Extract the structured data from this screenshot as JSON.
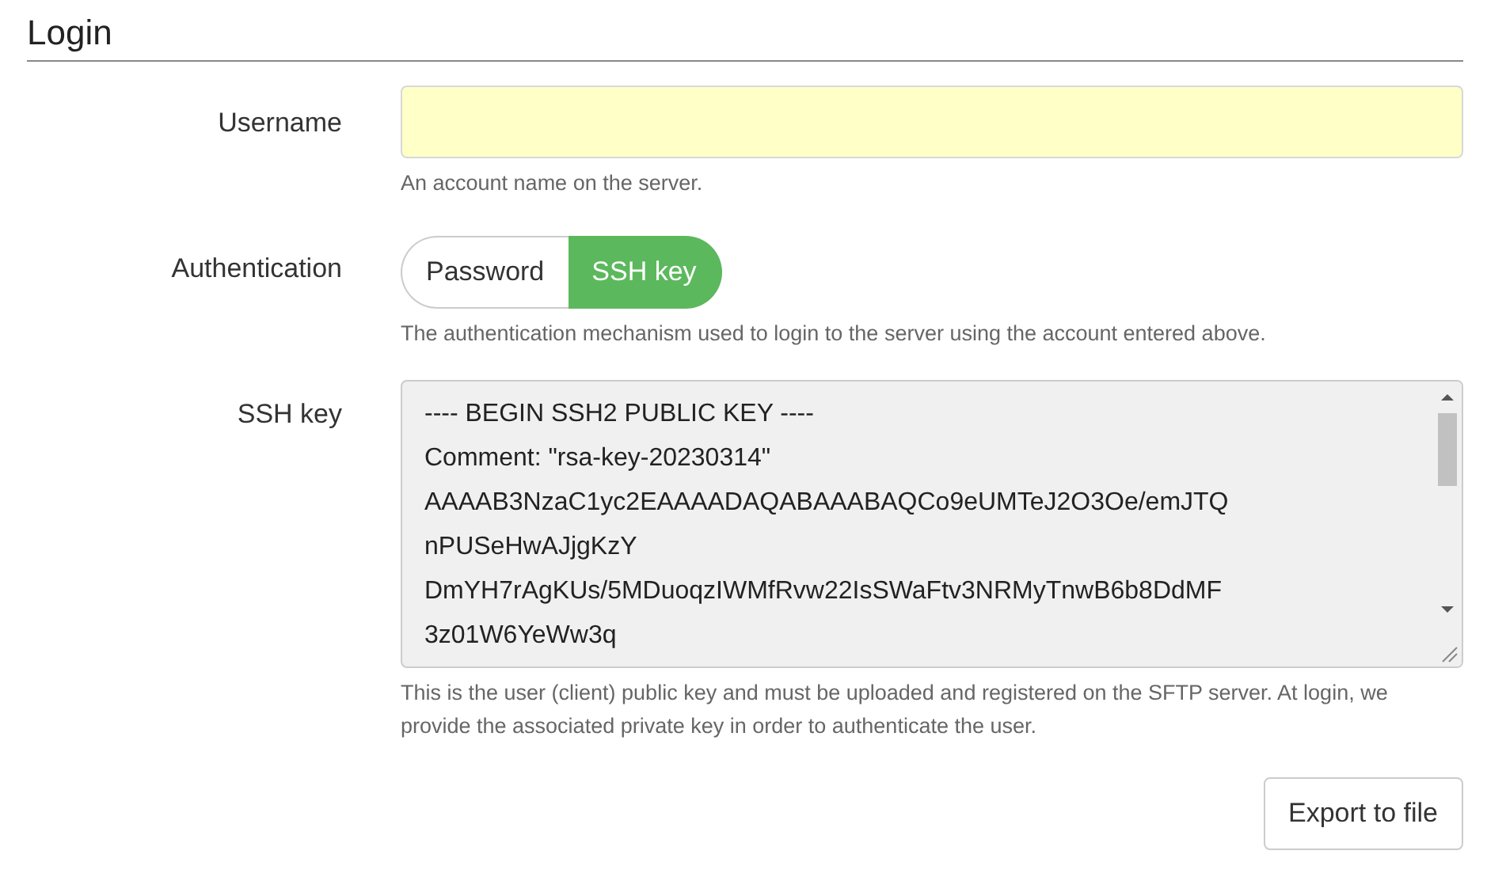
{
  "section": {
    "title": "Login"
  },
  "username": {
    "label": "Username",
    "help": "An account name on the server."
  },
  "authentication": {
    "label": "Authentication",
    "options": [
      {
        "label": "Password",
        "selected": false
      },
      {
        "label": "SSH key",
        "selected": true
      }
    ],
    "help": "The authentication mechanism used to login to the server using the account entered above."
  },
  "ssh_key": {
    "label": "SSH key",
    "lines": [
      "---- BEGIN SSH2 PUBLIC KEY ----",
      "Comment: \"rsa-key-20230314\"",
      "AAAAB3NzaC1yc2EAAAADAQABAAABAQCo9eUMTeJ2O3Oe/emJTQ",
      "nPUSeHwAJjgKzY",
      "DmYH7rAgKUs/5MDuoqzIWMfRvw22IsSWaFtv3NRMyTnwB6b8DdMF",
      "3z01W6YeWw3q"
    ],
    "help": "This is the user (client) public key and must be uploaded and registered on the SFTP server. At login, we provide the associated private key in order to authenticate the user."
  },
  "buttons": [
    {
      "label": "Export to file"
    }
  ]
}
